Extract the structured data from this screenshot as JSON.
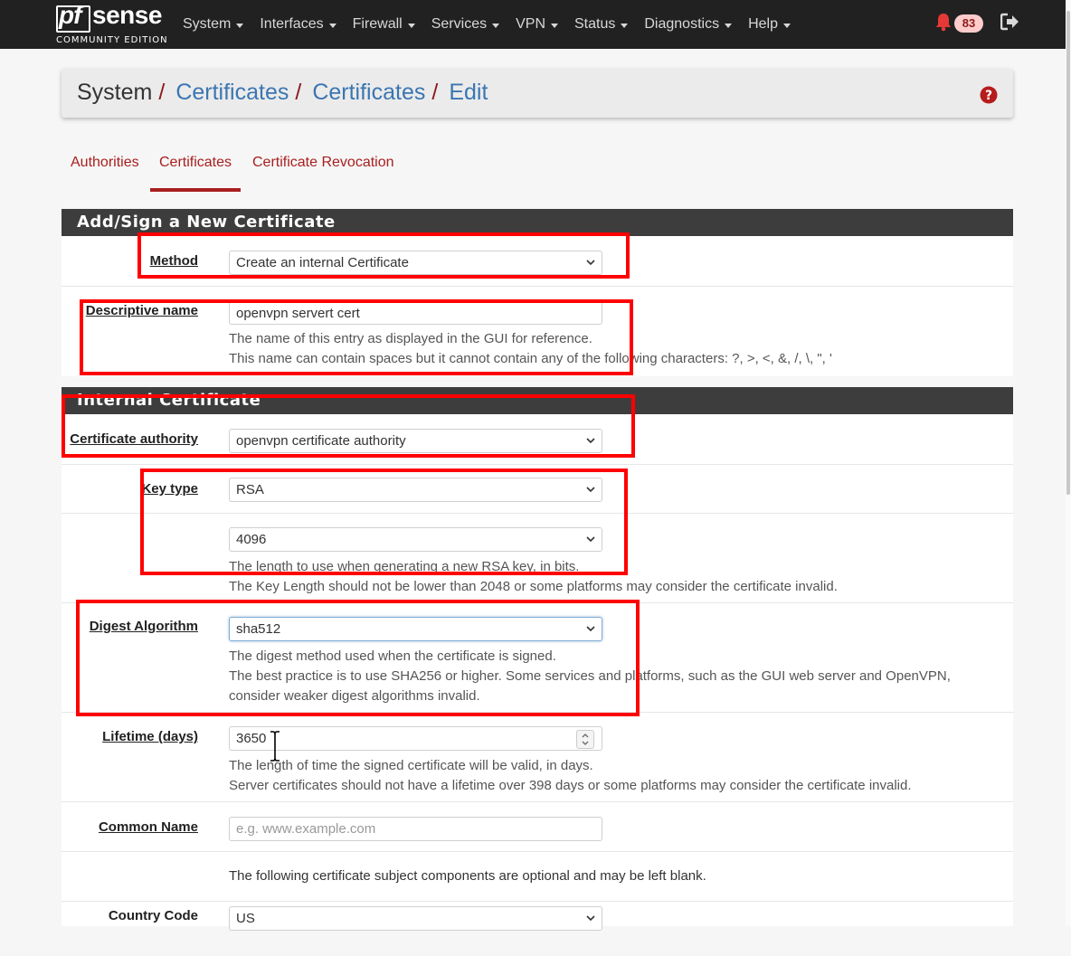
{
  "brand": {
    "logo_pf": "pf",
    "logo_sense": "sense",
    "edition": "COMMUNITY EDITION"
  },
  "nav": {
    "items": [
      "System",
      "Interfaces",
      "Firewall",
      "Services",
      "VPN",
      "Status",
      "Diagnostics",
      "Help"
    ],
    "notifications_count": "83",
    "icons": {
      "notifications": "bell-icon",
      "logout": "sign-out-icon"
    }
  },
  "breadcrumb": {
    "root": "System",
    "link1": "Certificates",
    "link2": "Certificates",
    "current": "Edit",
    "separator": "/"
  },
  "tabs": [
    {
      "label": "Authorities",
      "active": false
    },
    {
      "label": "Certificates",
      "active": true
    },
    {
      "label": "Certificate Revocation",
      "active": false
    }
  ],
  "section_add": {
    "title": "Add/Sign a New Certificate",
    "method": {
      "label": "Method",
      "value": "Create an internal Certificate"
    },
    "descr": {
      "label": "Descriptive name",
      "value": "openvpn servert cert",
      "help1": "The name of this entry as displayed in the GUI for reference.",
      "help2": "This name can contain spaces but it cannot contain any of the following characters: ?, >, <, &, /, \\, \", '"
    }
  },
  "section_internal": {
    "title": "Internal Certificate",
    "ca": {
      "label": "Certificate authority",
      "value": "openvpn certificate authority"
    },
    "keytype": {
      "label": "Key type",
      "value": "RSA"
    },
    "keylen": {
      "value": "4096",
      "help1": "The length to use when generating a new RSA key, in bits.",
      "help2": "The Key Length should not be lower than 2048 or some platforms may consider the certificate invalid."
    },
    "digest": {
      "label": "Digest Algorithm",
      "value": "sha512",
      "help1": "The digest method used when the certificate is signed.",
      "help2": "The best practice is to use SHA256 or higher. Some services and platforms, such as the GUI web server and OpenVPN,",
      "help3": "consider weaker digest algorithms invalid."
    },
    "lifetime": {
      "label": "Lifetime (days)",
      "value": "3650",
      "help1": "The length of time the signed certificate will be valid, in days.",
      "help2": "Server certificates should not have a lifetime over 398 days or some platforms may consider the certificate invalid."
    },
    "cn": {
      "label": "Common Name",
      "placeholder": "e.g. www.example.com"
    },
    "optional_note": "The following certificate subject components are optional and may be left blank.",
    "country": {
      "label": "Country Code",
      "value": "US"
    }
  },
  "colors": {
    "navbar": "#212121",
    "brand_red": "#a91e1e",
    "link_blue": "#3b76b2",
    "annotation_red": "#ff0000",
    "panel_heading": "#3d3d3d"
  }
}
